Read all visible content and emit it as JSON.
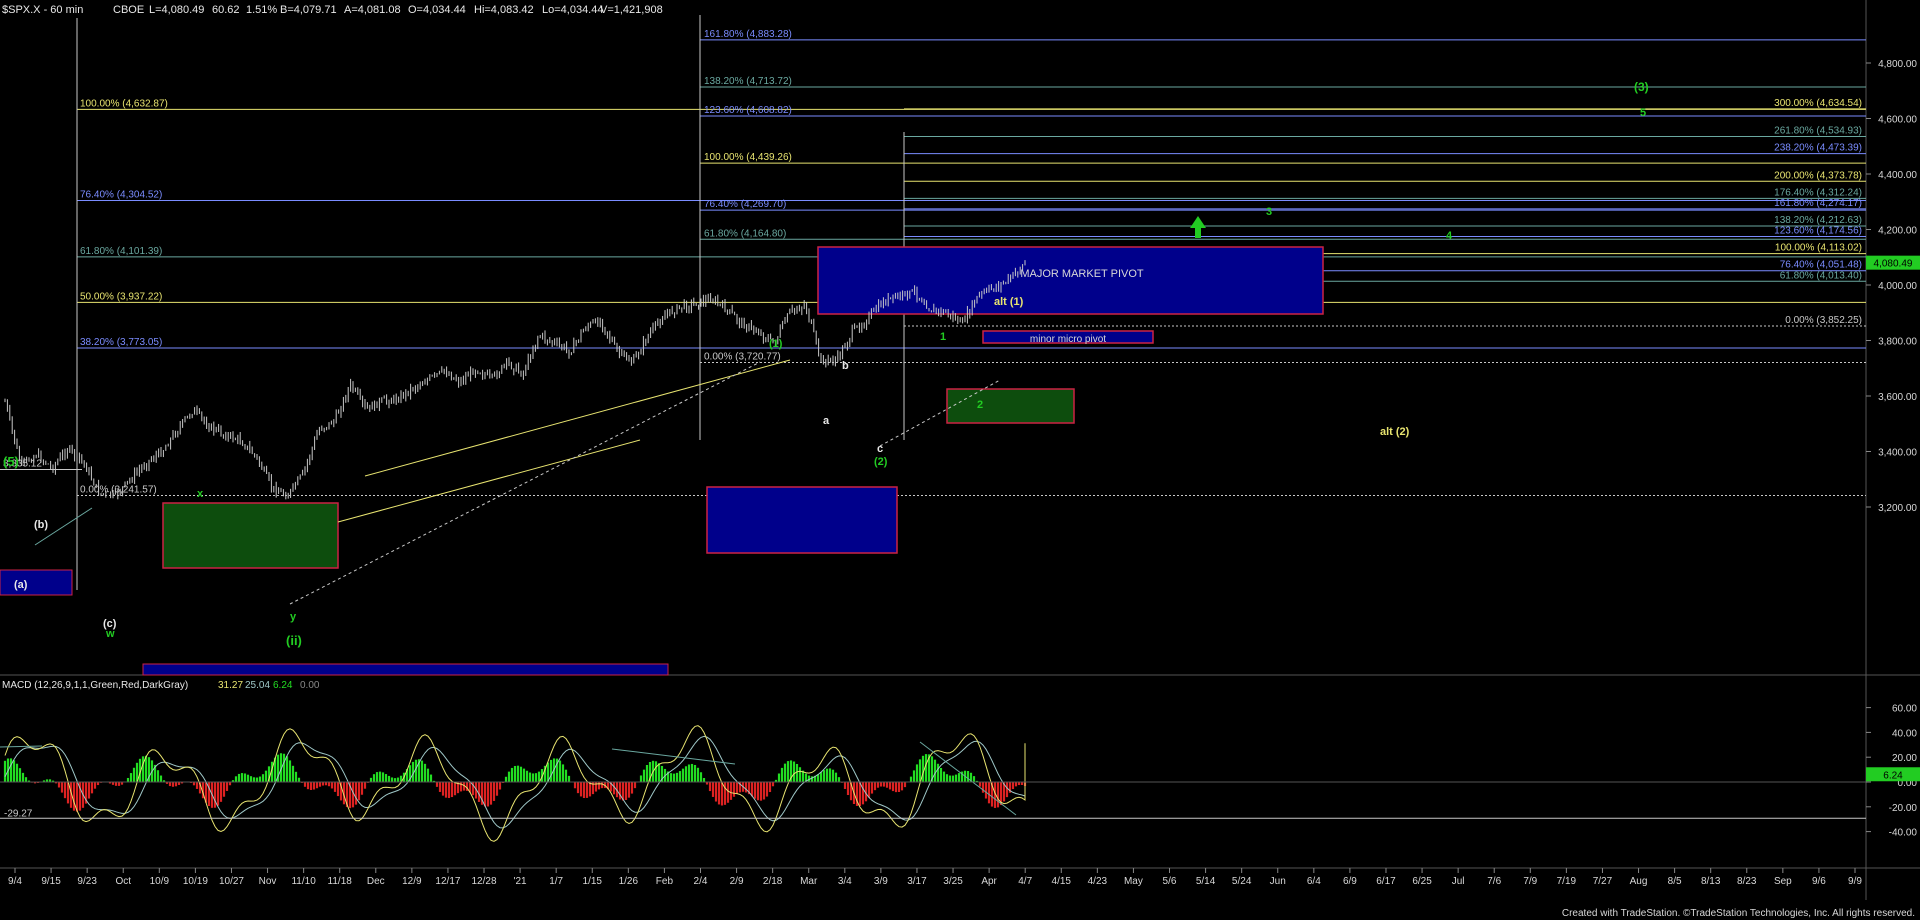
{
  "header": {
    "symbol": "$SPX.X - 60 min",
    "exchange": "CBOE",
    "last": "L=4,080.49",
    "change": "60.62",
    "change_pct": "1.51%",
    "bid": "B=4,079.71",
    "ask": "A=4,081.08",
    "open": "O=4,034.44",
    "high": "Hi=4,083.42",
    "low": "Lo=4,034.44",
    "volume": "V=1,421,908"
  },
  "footer": {
    "credit": "Created with TradeStation. ©TradeStation Technologies, Inc. All rights reserved."
  },
  "colors": {
    "background": "#000000",
    "candles": "#c8c8c8",
    "fib_left": "#7a8cff",
    "fib_yellow": "#e8e470",
    "fib_teal": "#6aa8a0",
    "wave_green": "#22cc22",
    "wave_yellow": "#e8e470",
    "macd_line": "#e8e470",
    "signal_line": "#9fc8c8",
    "hist_up": "#22dd22",
    "hist_down": "#dd2222",
    "box_blue": "#00008b",
    "box_border": "#cc2244",
    "box_green": "#0d4d0d"
  },
  "chart_data": [
    {
      "type": "candlestick",
      "title": "$SPX.X - 60 min",
      "ylim": [
        3050,
        5000
      ],
      "y_ticks": [
        "4,800.00",
        "4,600.00",
        "4,400.00",
        "4,200.00",
        "4,000.00",
        "3,800.00",
        "3,600.00",
        "3,400.00",
        "3,200.00"
      ],
      "y_tick_values": [
        4800,
        4600,
        4400,
        4200,
        4000,
        3800,
        3600,
        3400,
        3200
      ],
      "last_price_label": "4,080.49",
      "last_price_value": 4080.49,
      "x_tick_labels": [
        "9/4",
        "9/15",
        "9/23",
        "Oct",
        "10/9",
        "10/19",
        "10/27",
        "Nov",
        "11/10",
        "11/18",
        "Dec",
        "12/9",
        "12/17",
        "12/28",
        "'21",
        "1/7",
        "1/15",
        "1/26",
        "Feb",
        "2/4",
        "2/9",
        "2/18",
        "Mar",
        "3/4",
        "3/9",
        "3/17",
        "3/25",
        "Apr",
        "4/7",
        "4/15",
        "4/23",
        "May",
        "5/6",
        "5/14",
        "5/24",
        "Jun",
        "6/4",
        "6/9",
        "6/17",
        "6/25",
        "Jul",
        "7/6",
        "7/9",
        "7/19",
        "7/27",
        "Aug",
        "8/5",
        "8/13",
        "8/23",
        "Sep",
        "9/6",
        "9/9"
      ],
      "price_path": [
        {
          "x": "9/3",
          "y": 3580
        },
        {
          "x": "9/8",
          "y": 3350
        },
        {
          "x": "9/10",
          "y": 3390
        },
        {
          "x": "9/11",
          "y": 3340
        },
        {
          "x": "9/14",
          "y": 3410
        },
        {
          "x": "9/16",
          "y": 3360
        },
        {
          "x": "9/21",
          "y": 3250
        },
        {
          "x": "9/23",
          "y": 3240
        },
        {
          "x": "9/25",
          "y": 3300
        },
        {
          "x": "10/1",
          "y": 3360
        },
        {
          "x": "10/5",
          "y": 3400
        },
        {
          "x": "10/9",
          "y": 3480
        },
        {
          "x": "10/12",
          "y": 3550
        },
        {
          "x": "10/15",
          "y": 3490
        },
        {
          "x": "10/19",
          "y": 3460
        },
        {
          "x": "10/22",
          "y": 3440
        },
        {
          "x": "10/26",
          "y": 3380
        },
        {
          "x": "10/28",
          "y": 3270
        },
        {
          "x": "10/30",
          "y": 3240
        },
        {
          "x": "11/2",
          "y": 3320
        },
        {
          "x": "11/4",
          "y": 3480
        },
        {
          "x": "11/6",
          "y": 3510
        },
        {
          "x": "11/9",
          "y": 3640
        },
        {
          "x": "11/10",
          "y": 3550
        },
        {
          "x": "11/13",
          "y": 3580
        },
        {
          "x": "11/18",
          "y": 3590
        },
        {
          "x": "11/24",
          "y": 3630
        },
        {
          "x": "12/1",
          "y": 3660
        },
        {
          "x": "12/9",
          "y": 3690
        },
        {
          "x": "12/14",
          "y": 3650
        },
        {
          "x": "12/18",
          "y": 3700
        },
        {
          "x": "12/21",
          "y": 3660
        },
        {
          "x": "12/28",
          "y": 3720
        },
        {
          "x": "1/4",
          "y": 3680
        },
        {
          "x": "1/8",
          "y": 3820
        },
        {
          "x": "1/12",
          "y": 3790
        },
        {
          "x": "1/15",
          "y": 3760
        },
        {
          "x": "1/21",
          "y": 3850
        },
        {
          "x": "1/25",
          "y": 3870
        },
        {
          "x": "1/27",
          "y": 3760
        },
        {
          "x": "1/29",
          "y": 3720
        },
        {
          "x": "2/2",
          "y": 3820
        },
        {
          "x": "2/5",
          "y": 3890
        },
        {
          "x": "2/9",
          "y": 3920
        },
        {
          "x": "2/12",
          "y": 3934
        },
        {
          "x": "2/16",
          "y": 3950
        },
        {
          "x": "2/18",
          "y": 3910
        },
        {
          "x": "2/22",
          "y": 3860
        },
        {
          "x": "2/25",
          "y": 3830
        },
        {
          "x": "2/26",
          "y": 3790
        },
        {
          "x": "3/1",
          "y": 3900
        },
        {
          "x": "3/2",
          "y": 3930
        },
        {
          "x": "3/4",
          "y": 3725
        },
        {
          "x": "3/5",
          "y": 3730
        },
        {
          "x": "3/8",
          "y": 3830
        },
        {
          "x": "3/9",
          "y": 3880
        },
        {
          "x": "3/12",
          "y": 3940
        },
        {
          "x": "3/15",
          "y": 3960
        },
        {
          "x": "3/17",
          "y": 3975
        },
        {
          "x": "3/19",
          "y": 3910
        },
        {
          "x": "3/23",
          "y": 3900
        },
        {
          "x": "3/25",
          "y": 3860
        },
        {
          "x": "3/29",
          "y": 3960
        },
        {
          "x": "3/31",
          "y": 3990
        },
        {
          "x": "4/1",
          "y": 4020
        },
        {
          "x": "4/5",
          "y": 4080
        }
      ]
    },
    {
      "type": "line",
      "title": "MACD (12,26,9,1,1,Green,Red,DarkGray)",
      "readings": [
        "31.27",
        "25.04",
        "6.24",
        "0.00"
      ],
      "ylim": [
        -50,
        68
      ],
      "y_ticks": [
        "60.00",
        "40.00",
        "20.00",
        "0.00",
        "-20.00",
        "-40.00"
      ],
      "y_tick_values": [
        60,
        40,
        20,
        0,
        -20,
        -40
      ],
      "left_marker": "-29.27",
      "left_marker_value": -29.27,
      "last_label": "6.24",
      "last_value": 6.24,
      "last_macd_label": "31.27",
      "last_macd_value": 31.27,
      "last_signal_label": "25.04",
      "last_signal_value": 25.04
    }
  ],
  "fib_left": [
    {
      "label": "100.00% (4,632.87)",
      "value": 4632.87,
      "color": "#e8e470"
    },
    {
      "label": "76.40% (4,304.52)",
      "value": 4304.52,
      "color": "#7a8cff"
    },
    {
      "label": "61.80% (4,101.39)",
      "value": 4101.39,
      "color": "#6aa8a0"
    },
    {
      "label": "50.00% (3,937.22)",
      "value": 3937.22,
      "color": "#e8e470"
    },
    {
      "label": "38.20% (3,773.05)",
      "value": 3773.05,
      "color": "#7a8cff"
    },
    {
      "label": "0.00% (3,241.57)",
      "value": 3241.57,
      "color": "#c8c8c8"
    }
  ],
  "fib_mid": [
    {
      "label": "161.80% (4,883.28)",
      "value": 4883.28,
      "color": "#7a8cff"
    },
    {
      "label": "138.20% (4,713.72)",
      "value": 4713.72,
      "color": "#6aa8a0"
    },
    {
      "label": "123.60% (4,608.82)",
      "value": 4608.82,
      "color": "#7a8cff"
    },
    {
      "label": "100.00% (4,439.26)",
      "value": 4439.26,
      "color": "#e8e470"
    },
    {
      "label": "76.40% (4,269.70)",
      "value": 4269.7,
      "color": "#7a8cff"
    },
    {
      "label": "61.80% (4,164.80)",
      "value": 4164.8,
      "color": "#6aa8a0"
    },
    {
      "label": "0.00% (3,720.77)",
      "value": 3720.77,
      "color": "#c8c8c8"
    }
  ],
  "fib_right": [
    {
      "label": "300.00% (4,634.54)",
      "value": 4634.54,
      "color": "#e8e470"
    },
    {
      "label": "261.80% (4,534.93)",
      "value": 4534.93,
      "color": "#6aa8a0"
    },
    {
      "label": "238.20% (4,473.39)",
      "value": 4473.39,
      "color": "#7a8cff"
    },
    {
      "label": "200.00% (4,373.78)",
      "value": 4373.78,
      "color": "#e8e470"
    },
    {
      "label": "176.40% (4,312.24)",
      "value": 4312.24,
      "color": "#6aa8a0"
    },
    {
      "label": "161.80% (4,274.17)",
      "value": 4274.17,
      "color": "#7a8cff"
    },
    {
      "label": "138.20% (4,212.63)",
      "value": 4212.63,
      "color": "#6aa8a0"
    },
    {
      "label": "123.60% (4,174.56)",
      "value": 4174.56,
      "color": "#7a8cff"
    },
    {
      "label": "100.00% (4,113.02)",
      "value": 4113.02,
      "color": "#e8e470"
    },
    {
      "label": "76.40% (4,051.48)",
      "value": 4051.48,
      "color": "#7a8cff"
    },
    {
      "label": "61.80% (4,013.40)",
      "value": 4013.4,
      "color": "#6aa8a0"
    },
    {
      "label": "0.00% (3,852.25)",
      "value": 3852.25,
      "color": "#c8c8c8"
    }
  ],
  "fib_partial": [
    {
      "label": "3,335.12",
      "value": 3335.12,
      "color": "#c8c8c8"
    }
  ],
  "zones": {
    "major_pivot_label": "MAJOR MARKET PIVOT",
    "micro_pivot_label": "minor micro pivot"
  },
  "wave_labels": {
    "five_left": "(5)",
    "w": "w",
    "x": "x",
    "y": "y",
    "ii": "(ii)",
    "a_paren": "(a)",
    "b_paren": "(b)",
    "c_paren": "(c)",
    "wave1": "(1)",
    "a": "a",
    "b": "b",
    "c": "c",
    "wave2": "(2)",
    "alt1": "alt (1)",
    "alt2": "alt (2)",
    "one": "1",
    "two": "2",
    "three": "3",
    "four": "4",
    "five": "5",
    "wave3": "(3)"
  }
}
